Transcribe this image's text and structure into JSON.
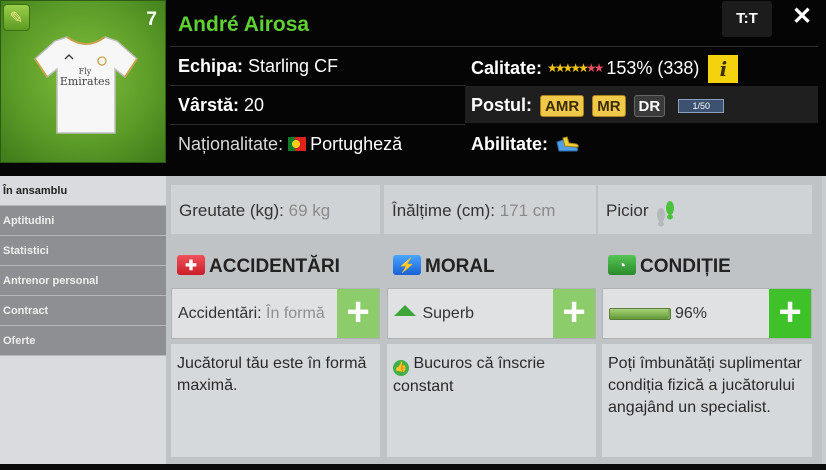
{
  "player": {
    "name": "André Airosa",
    "shirt_number": "7",
    "jersey_sponsor_line1": "Fly",
    "jersey_sponsor_line2": "Emirates"
  },
  "header": {
    "team_label": "Echipa:",
    "team_value": "Starling CF",
    "age_label": "Vârstă:",
    "age_value": "20",
    "nationality_label": "Naționalitate:",
    "nationality_value": "Portugheză",
    "quality_label": "Calitate:",
    "quality_value": "153% (338)",
    "quality_stars_gold": "★★★★★",
    "quality_stars_red": "★★",
    "info_button": "i",
    "position_label": "Postul:",
    "positions": [
      "AMR",
      "MR",
      "DR"
    ],
    "position_progress": "1/50",
    "ability_label": "Abilitate:",
    "compare_button": "T:T",
    "close_button": "✕"
  },
  "sidebar": {
    "items": [
      {
        "label": "În ansamblu",
        "active": true
      },
      {
        "label": "Aptitudini",
        "active": false
      },
      {
        "label": "Statistici",
        "active": false
      },
      {
        "label": "Antrenor personal",
        "active": false
      },
      {
        "label": "Contract",
        "active": false
      },
      {
        "label": "Oferte",
        "active": false
      }
    ]
  },
  "stats": {
    "weight_label": "Greutate (kg):",
    "weight_value": "69 kg",
    "height_label": "Înălțime (cm):",
    "height_value": "171 cm",
    "foot_label": "Picior"
  },
  "sections": {
    "injuries": {
      "title": "ACCIDENTĂRI",
      "status_label": "Accidentări:",
      "status_value": "În formă",
      "description": "Jucătorul tău este în formă maximă."
    },
    "morale": {
      "title": "MORAL",
      "status_value": "Superb",
      "description": "Bucuros că înscrie constant"
    },
    "condition": {
      "title": "CONDIȚIE",
      "percent_text": "96%",
      "level": 0.96,
      "description": "Poți îmbunătăți suplimentar condiția fizică a jucătorului angajând un specialist."
    }
  },
  "icons": {
    "edit": "pencil-icon",
    "injury": "medical-cross-icon",
    "morale": "lightning-icon",
    "condition": "stopwatch-icon",
    "foot": "footprint-icon",
    "flag": "portugal-flag-icon",
    "ability": "boots-icon",
    "morale_status": "up-arrow-icon",
    "morale_desc": "thumbs-up-icon"
  },
  "colors": {
    "name_green": "#5fd033",
    "plus_bright": "#3fc12a",
    "plus_light": "#8ccc6a",
    "position_gold": "#f0c94a",
    "info_yellow": "#f4d20e"
  }
}
